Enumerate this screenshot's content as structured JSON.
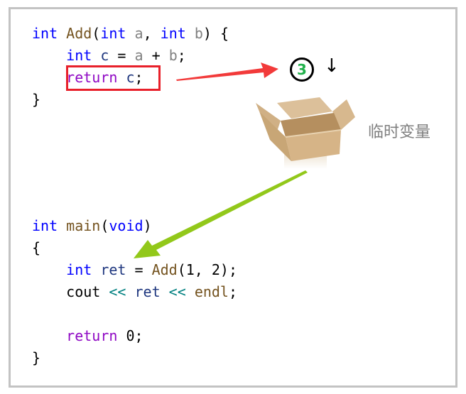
{
  "code_top": {
    "lines": [
      [
        {
          "t": "int",
          "c": "kw"
        },
        {
          "t": " ",
          "c": "plain"
        },
        {
          "t": "Add",
          "c": "fn"
        },
        {
          "t": "(",
          "c": "plain"
        },
        {
          "t": "int",
          "c": "kw"
        },
        {
          "t": " a",
          "c": "param"
        },
        {
          "t": ", ",
          "c": "plain"
        },
        {
          "t": "int",
          "c": "kw"
        },
        {
          "t": " b",
          "c": "param"
        },
        {
          "t": ") {",
          "c": "plain"
        }
      ],
      [
        {
          "t": "    ",
          "c": "plain"
        },
        {
          "t": "int",
          "c": "kw"
        },
        {
          "t": " c",
          "c": "var"
        },
        {
          "t": " = ",
          "c": "plain"
        },
        {
          "t": "a",
          "c": "param"
        },
        {
          "t": " + ",
          "c": "plain"
        },
        {
          "t": "b",
          "c": "param"
        },
        {
          "t": ";",
          "c": "plain"
        }
      ],
      [
        {
          "t": "    ",
          "c": "plain"
        },
        {
          "t": "return",
          "c": "ret"
        },
        {
          "t": " c",
          "c": "var"
        },
        {
          "t": ";",
          "c": "plain"
        }
      ],
      [
        {
          "t": "}",
          "c": "plain"
        }
      ]
    ]
  },
  "code_bottom": {
    "lines": [
      [
        {
          "t": "int",
          "c": "kw"
        },
        {
          "t": " ",
          "c": "plain"
        },
        {
          "t": "main",
          "c": "fn"
        },
        {
          "t": "(",
          "c": "plain"
        },
        {
          "t": "void",
          "c": "kw"
        },
        {
          "t": ")",
          "c": "plain"
        }
      ],
      [
        {
          "t": "{",
          "c": "plain"
        }
      ],
      [
        {
          "t": "    ",
          "c": "plain"
        },
        {
          "t": "int",
          "c": "kw"
        },
        {
          "t": " ret",
          "c": "var"
        },
        {
          "t": " = ",
          "c": "plain"
        },
        {
          "t": "Add",
          "c": "fn"
        },
        {
          "t": "(1, 2);",
          "c": "plain"
        }
      ],
      [
        {
          "t": "    ",
          "c": "plain"
        },
        {
          "t": "cout",
          "c": "plain"
        },
        {
          "t": " << ",
          "c": "op"
        },
        {
          "t": "ret",
          "c": "var"
        },
        {
          "t": " << ",
          "c": "op"
        },
        {
          "t": "endl",
          "c": "fn"
        },
        {
          "t": ";",
          "c": "plain"
        }
      ],
      [
        {
          "t": "",
          "c": "plain"
        }
      ],
      [
        {
          "t": "    ",
          "c": "plain"
        },
        {
          "t": "return",
          "c": "ret"
        },
        {
          "t": " 0;",
          "c": "plain"
        }
      ],
      [
        {
          "t": "}",
          "c": "plain"
        }
      ]
    ]
  },
  "annotations": {
    "step_number": "3",
    "down_arrow": "↓",
    "temp_variable_label": "临时变量",
    "highlighted_statement": "return c;"
  },
  "colors": {
    "highlight_border": "#e8202a",
    "red_arrow": "#f23a3a",
    "green_arrow": "#92c81a",
    "step_number": "#22b14c",
    "frame_border": "#c3c3c3"
  },
  "icons": {
    "box": "cardboard-box-icon",
    "step": "step-number-badge",
    "arrow_down": "down-arrow-icon"
  }
}
